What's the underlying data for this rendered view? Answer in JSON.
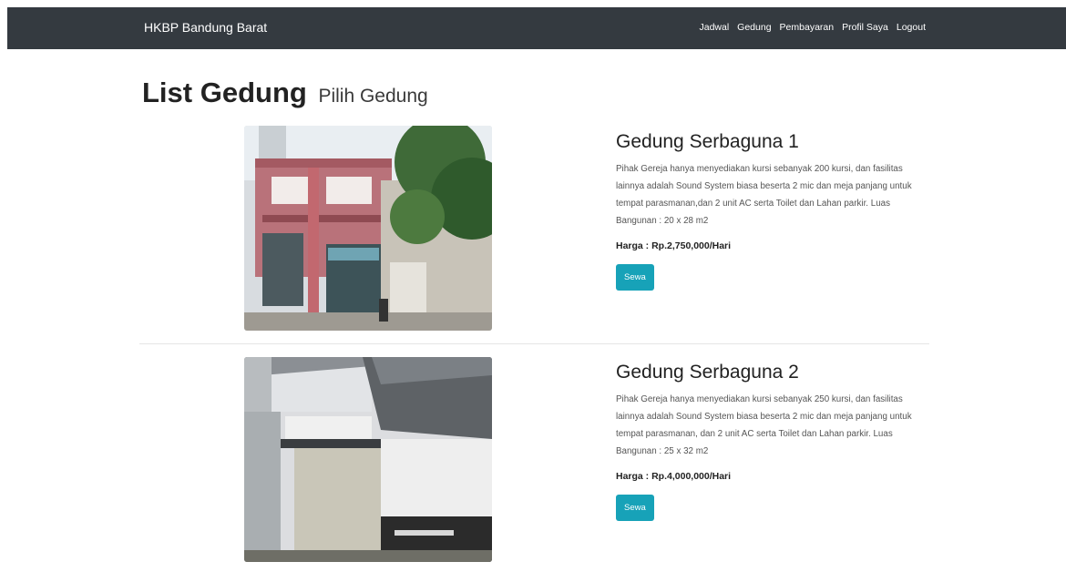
{
  "navbar": {
    "brand": "HKBP Bandung Barat",
    "links": [
      "Jadwal",
      "Gedung",
      "Pembayaran",
      "Profil Saya",
      "Logout"
    ]
  },
  "page": {
    "title": "List Gedung",
    "subtitle": "Pilih Gedung"
  },
  "buildings": [
    {
      "name": "Gedung Serbaguna 1",
      "description": "Pihak Gereja hanya menyediakan kursi sebanyak 200 kursi, dan fasilitas lainnya adalah Sound System biasa beserta 2 mic dan meja panjang untuk tempat parasmanan,dan 2 unit AC serta Toilet dan Lahan parkir. Luas Bangunan : 20 x 28 m2",
      "price": "Harga : Rp.2,750,000/Hari",
      "button": "Sewa"
    },
    {
      "name": "Gedung Serbaguna 2",
      "description": "Pihak Gereja hanya menyediakan kursi sebanyak 250 kursi, dan fasilitas lainnya adalah Sound System biasa beserta 2 mic dan meja panjang untuk tempat parasmanan, dan 2 unit AC serta Toilet dan Lahan parkir. Luas Bangunan : 25 x 32 m2",
      "price": "Harga : Rp.4,000,000/Hari",
      "button": "Sewa"
    }
  ],
  "colors": {
    "navbar": "#343a40",
    "button": "#17a2b8"
  }
}
